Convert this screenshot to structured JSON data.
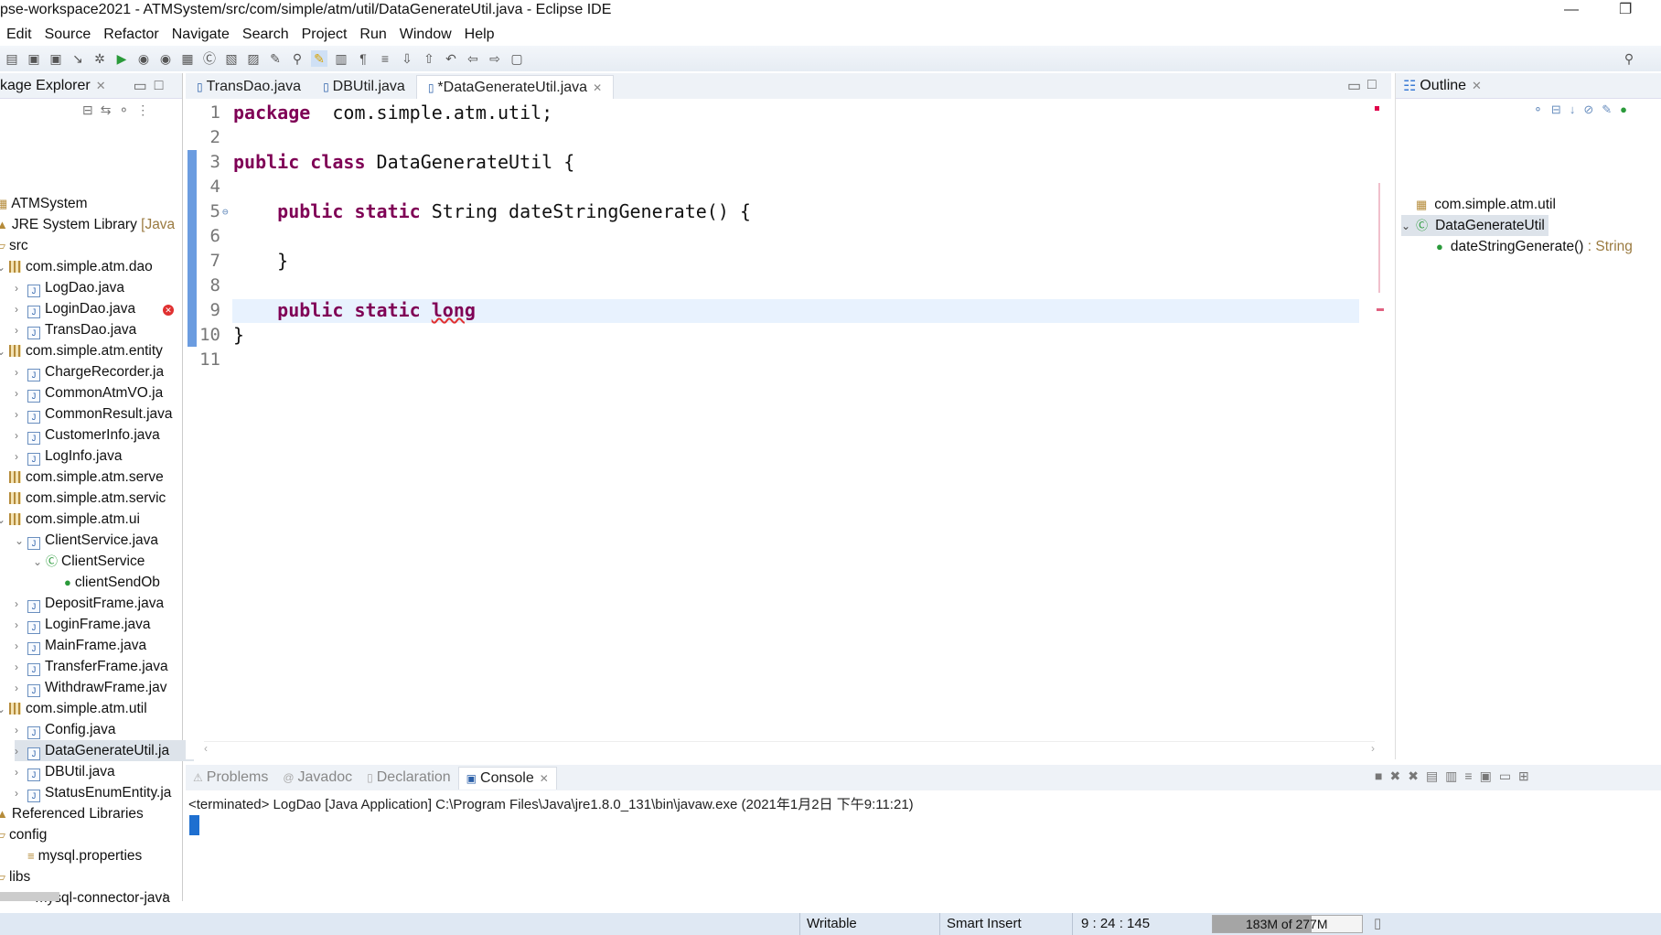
{
  "window": {
    "title": "pse-workspace2021 - ATMSystem/src/com/simple/atm/util/DataGenerateUtil.java - Eclipse IDE"
  },
  "menu": [
    "Edit",
    "Source",
    "Refactor",
    "Navigate",
    "Search",
    "Project",
    "Run",
    "Window",
    "Help"
  ],
  "package_explorer": {
    "title": "kage Explorer",
    "items": [
      {
        "label": "ATMSystem",
        "depth": 0,
        "icon": "project"
      },
      {
        "label": "JRE System Library",
        "suffix": " [JavaS",
        "depth": 0,
        "icon": "library"
      },
      {
        "label": "src",
        "depth": 0,
        "icon": "folder"
      },
      {
        "label": "com.simple.atm.dao",
        "depth": 0,
        "icon": "package",
        "twisty": "open"
      },
      {
        "label": "LogDao.java",
        "depth": 1,
        "icon": "java",
        "twisty": "closed"
      },
      {
        "label": "LoginDao.java",
        "depth": 1,
        "icon": "java",
        "twisty": "closed"
      },
      {
        "label": "TransDao.java",
        "depth": 1,
        "icon": "java",
        "twisty": "closed"
      },
      {
        "label": "com.simple.atm.entity",
        "depth": 0,
        "icon": "package",
        "twisty": "open"
      },
      {
        "label": "ChargeRecorder.ja",
        "depth": 1,
        "icon": "java",
        "twisty": "closed"
      },
      {
        "label": "CommonAtmVO.ja",
        "depth": 1,
        "icon": "java",
        "twisty": "closed"
      },
      {
        "label": "CommonResult.java",
        "depth": 1,
        "icon": "java",
        "twisty": "closed"
      },
      {
        "label": "CustomerInfo.java",
        "depth": 1,
        "icon": "java",
        "twisty": "closed"
      },
      {
        "label": "LogInfo.java",
        "depth": 1,
        "icon": "java",
        "twisty": "closed"
      },
      {
        "label": "com.simple.atm.serve",
        "depth": 0,
        "icon": "package",
        "twisty": "closed"
      },
      {
        "label": "com.simple.atm.servic",
        "depth": 0,
        "icon": "package",
        "twisty": "closed"
      },
      {
        "label": "com.simple.atm.ui",
        "depth": 0,
        "icon": "package",
        "twisty": "open"
      },
      {
        "label": "ClientService.java",
        "depth": 1,
        "icon": "java",
        "twisty": "open"
      },
      {
        "label": "ClientService",
        "depth": 2,
        "icon": "class",
        "twisty": "open"
      },
      {
        "label": "clientSendOb",
        "depth": 3,
        "icon": "field"
      },
      {
        "label": "DepositFrame.java",
        "depth": 1,
        "icon": "java",
        "twisty": "closed"
      },
      {
        "label": "LoginFrame.java",
        "depth": 1,
        "icon": "java",
        "twisty": "closed"
      },
      {
        "label": "MainFrame.java",
        "depth": 1,
        "icon": "java",
        "twisty": "closed"
      },
      {
        "label": "TransferFrame.java",
        "depth": 1,
        "icon": "java",
        "twisty": "closed"
      },
      {
        "label": "WithdrawFrame.jav",
        "depth": 1,
        "icon": "java",
        "twisty": "closed"
      },
      {
        "label": "com.simple.atm.util",
        "depth": 0,
        "icon": "package",
        "twisty": "open"
      },
      {
        "label": "Config.java",
        "depth": 1,
        "icon": "java",
        "twisty": "closed"
      },
      {
        "label": "DataGenerateUtil.ja",
        "depth": 1,
        "icon": "java",
        "twisty": "closed",
        "selected": true
      },
      {
        "label": "DBUtil.java",
        "depth": 1,
        "icon": "java",
        "twisty": "closed"
      },
      {
        "label": "StatusEnumEntity.ja",
        "depth": 1,
        "icon": "java",
        "twisty": "closed"
      },
      {
        "label": "Referenced Libraries",
        "depth": 0,
        "icon": "library"
      },
      {
        "label": "config",
        "depth": 0,
        "icon": "folder"
      },
      {
        "label": "mysql.properties",
        "depth": 1,
        "icon": "file"
      },
      {
        "label": "libs",
        "depth": 0,
        "icon": "folder"
      },
      {
        "label": "mysql-connector-java",
        "depth": 1,
        "icon": "jar"
      }
    ]
  },
  "editor": {
    "tabs": [
      {
        "label": "TransDao.java"
      },
      {
        "label": "DBUtil.java"
      },
      {
        "label": "*DataGenerateUtil.java",
        "active": true
      }
    ],
    "lines": [
      {
        "n": "1",
        "tokens": [
          [
            "kw",
            "package"
          ],
          [
            "",
            "  com.simple.atm.util;"
          ]
        ]
      },
      {
        "n": "2",
        "tokens": []
      },
      {
        "n": "3",
        "tokens": [
          [
            "kw",
            "public"
          ],
          [
            "",
            " "
          ],
          [
            "kw",
            "class"
          ],
          [
            "",
            " DataGenerateUtil {"
          ]
        ]
      },
      {
        "n": "4",
        "tokens": []
      },
      {
        "n": "5",
        "tokens": [
          [
            "",
            "    "
          ],
          [
            "kw",
            "public"
          ],
          [
            "",
            " "
          ],
          [
            "kw",
            "static"
          ],
          [
            "",
            " String dateStringGenerate() {"
          ]
        ]
      },
      {
        "n": "6",
        "tokens": []
      },
      {
        "n": "7",
        "tokens": [
          [
            "",
            "    }"
          ]
        ]
      },
      {
        "n": "8",
        "tokens": []
      },
      {
        "n": "9",
        "tokens": [
          [
            "",
            "    "
          ],
          [
            "kw",
            "public"
          ],
          [
            "",
            " "
          ],
          [
            "kw",
            "static"
          ],
          [
            "",
            " "
          ],
          [
            "kw",
            "long"
          ]
        ],
        "current": true,
        "error": true
      },
      {
        "n": "10",
        "tokens": [
          [
            "",
            "}"
          ]
        ]
      },
      {
        "n": "11",
        "tokens": []
      }
    ]
  },
  "outline": {
    "title": "Outline",
    "items": [
      {
        "label": "com.simple.atm.util",
        "icon": "package"
      },
      {
        "label": "DataGenerateUtil",
        "icon": "class",
        "selected": true
      },
      {
        "label": "dateStringGenerate()",
        "type": " : String",
        "icon": "method"
      }
    ]
  },
  "console": {
    "tabs": [
      "Problems",
      "Javadoc",
      "Declaration",
      "Console"
    ],
    "active_tab": "Console",
    "header": "<terminated> LogDao [Java Application] C:\\Program Files\\Java\\jre1.8.0_131\\bin\\javaw.exe (2021年1月2日 下午9:11:21)"
  },
  "statusbar": {
    "writable": "Writable",
    "insert_mode": "Smart Insert",
    "position": "9 : 24 : 145",
    "heap": "183M of 277M"
  },
  "colors": {
    "keyword": "#7f0055",
    "selection": "#dde3ea",
    "current_line": "#e8f2fe",
    "accent": "#3a7bd5"
  }
}
